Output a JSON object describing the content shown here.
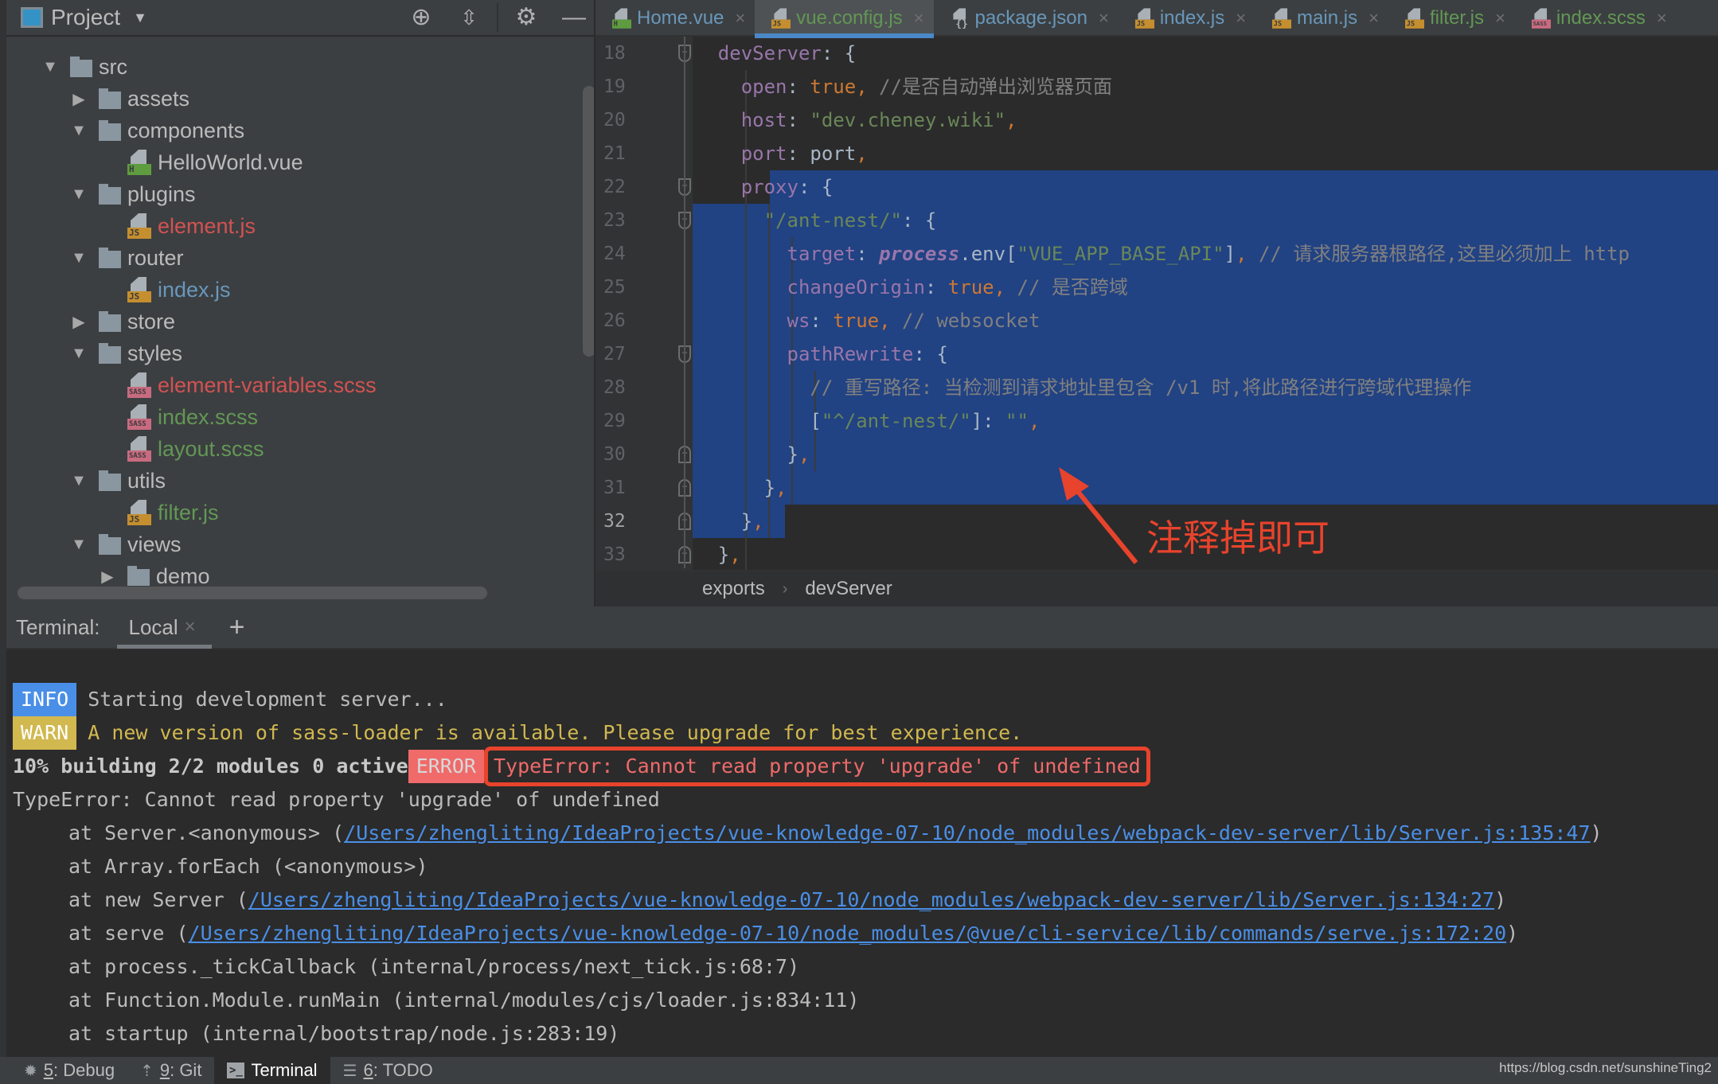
{
  "project_panel": {
    "title": "Project",
    "tools": [
      "locate-icon",
      "collapse-all-icon",
      "gear-icon",
      "minimize-icon"
    ],
    "tree": [
      {
        "label": "src",
        "kind": "folder",
        "depth": 0,
        "expanded": true,
        "color": "gray"
      },
      {
        "label": "assets",
        "kind": "folder",
        "depth": 1,
        "expanded": false,
        "color": "gray"
      },
      {
        "label": "components",
        "kind": "folder",
        "depth": 1,
        "expanded": true,
        "color": "gray"
      },
      {
        "label": "HelloWorld.vue",
        "kind": "vue",
        "depth": 2,
        "color": "gray"
      },
      {
        "label": "plugins",
        "kind": "folder",
        "depth": 1,
        "expanded": true,
        "color": "gray"
      },
      {
        "label": "element.js",
        "kind": "js",
        "depth": 2,
        "color": "red"
      },
      {
        "label": "router",
        "kind": "folder",
        "depth": 1,
        "expanded": true,
        "color": "gray"
      },
      {
        "label": "index.js",
        "kind": "js",
        "depth": 2,
        "color": "blue"
      },
      {
        "label": "store",
        "kind": "folder",
        "depth": 1,
        "expanded": false,
        "color": "gray"
      },
      {
        "label": "styles",
        "kind": "folder",
        "depth": 1,
        "expanded": true,
        "color": "gray"
      },
      {
        "label": "element-variables.scss",
        "kind": "sass",
        "depth": 2,
        "color": "red"
      },
      {
        "label": "index.scss",
        "kind": "sass",
        "depth": 2,
        "color": "green"
      },
      {
        "label": "layout.scss",
        "kind": "sass",
        "depth": 2,
        "color": "green"
      },
      {
        "label": "utils",
        "kind": "folder",
        "depth": 1,
        "expanded": true,
        "color": "gray"
      },
      {
        "label": "filter.js",
        "kind": "js",
        "depth": 2,
        "color": "green"
      },
      {
        "label": "views",
        "kind": "folder",
        "depth": 1,
        "expanded": true,
        "color": "gray"
      },
      {
        "label": "demo",
        "kind": "folder",
        "depth": 2,
        "expanded": false,
        "color": "gray"
      }
    ]
  },
  "editor": {
    "tabs": [
      {
        "label": "Home.vue",
        "kind": "vue",
        "color": "blue",
        "active": false
      },
      {
        "label": "vue.config.js",
        "kind": "js",
        "color": "green",
        "active": true
      },
      {
        "label": "package.json",
        "kind": "json",
        "color": "blue",
        "active": false
      },
      {
        "label": "index.js",
        "kind": "js",
        "color": "blue",
        "active": false
      },
      {
        "label": "main.js",
        "kind": "js",
        "color": "blue",
        "active": false
      },
      {
        "label": "filter.js",
        "kind": "js",
        "color": "green",
        "active": false
      },
      {
        "label": "index.scss",
        "kind": "sass",
        "color": "green",
        "active": false
      }
    ],
    "current_line": 32,
    "lines": [
      {
        "n": 18,
        "fold": "open",
        "tokens": [
          [
            "    ",
            "plain"
          ],
          [
            "devServer",
            "prop"
          ],
          [
            ": {",
            "plain"
          ]
        ]
      },
      {
        "n": 19,
        "tokens": [
          [
            "      ",
            "plain"
          ],
          [
            "open",
            "prop"
          ],
          [
            ": ",
            "plain"
          ],
          [
            "true,",
            "kw"
          ],
          [
            " //是否自动弹出浏览器页面",
            "cmt"
          ]
        ]
      },
      {
        "n": 20,
        "tokens": [
          [
            "      ",
            "plain"
          ],
          [
            "host",
            "prop"
          ],
          [
            ": ",
            "plain"
          ],
          [
            "\"dev.cheney.wiki\"",
            "str"
          ],
          [
            ",",
            "kw"
          ]
        ]
      },
      {
        "n": 21,
        "tokens": [
          [
            "      ",
            "plain"
          ],
          [
            "port",
            "prop"
          ],
          [
            ": port",
            "plain"
          ],
          [
            ",",
            "kw"
          ]
        ]
      },
      {
        "n": 22,
        "fold": "open",
        "tokens": [
          [
            "      ",
            "plain"
          ],
          [
            "proxy",
            "prop"
          ],
          [
            ": {",
            "plain"
          ]
        ]
      },
      {
        "n": 23,
        "fold": "open",
        "tokens": [
          [
            "        ",
            "plain"
          ],
          [
            "\"/ant-nest/\"",
            "str"
          ],
          [
            ": {",
            "plain"
          ]
        ]
      },
      {
        "n": 24,
        "tokens": [
          [
            "          ",
            "plain"
          ],
          [
            "target",
            "prop"
          ],
          [
            ": ",
            "plain"
          ],
          [
            "process",
            "italic"
          ],
          [
            ".env[",
            "plain"
          ],
          [
            "\"VUE_APP_BASE_API\"",
            "str"
          ],
          [
            "]",
            "plain"
          ],
          [
            ",",
            "kw"
          ],
          [
            " // 请求服务器根路径,这里必须加上 http",
            "cmt"
          ]
        ]
      },
      {
        "n": 25,
        "tokens": [
          [
            "          ",
            "plain"
          ],
          [
            "changeOrigin",
            "prop"
          ],
          [
            ": ",
            "plain"
          ],
          [
            "true,",
            "kw"
          ],
          [
            " // 是否跨域",
            "cmt"
          ]
        ]
      },
      {
        "n": 26,
        "tokens": [
          [
            "          ",
            "plain"
          ],
          [
            "ws",
            "prop"
          ],
          [
            ": ",
            "plain"
          ],
          [
            "true,",
            "kw"
          ],
          [
            " // websocket",
            "cmt"
          ]
        ]
      },
      {
        "n": 27,
        "fold": "open",
        "tokens": [
          [
            "          ",
            "plain"
          ],
          [
            "pathRewrite",
            "prop"
          ],
          [
            ": {",
            "plain"
          ]
        ]
      },
      {
        "n": 28,
        "tokens": [
          [
            "            ",
            "plain"
          ],
          [
            "// 重写路径: 当检测到请求地址里包含 /v1 时,将此路径进行跨域代理操作",
            "cmt"
          ]
        ]
      },
      {
        "n": 29,
        "tokens": [
          [
            "            ",
            "plain"
          ],
          [
            "[",
            "plain"
          ],
          [
            "\"^/ant-nest/\"",
            "str"
          ],
          [
            "]: ",
            "plain"
          ],
          [
            "\"\"",
            "str"
          ],
          [
            ",",
            "kw"
          ]
        ]
      },
      {
        "n": 30,
        "fold": "close",
        "tokens": [
          [
            "          ",
            "plain"
          ],
          [
            "}",
            "plain"
          ],
          [
            ",",
            "kw"
          ]
        ]
      },
      {
        "n": 31,
        "fold": "close",
        "tokens": [
          [
            "        ",
            "plain"
          ],
          [
            "}",
            "plain"
          ],
          [
            ",",
            "kw"
          ]
        ]
      },
      {
        "n": 32,
        "fold": "close",
        "tokens": [
          [
            "      ",
            "plain"
          ],
          [
            "}",
            "plain"
          ],
          [
            ",",
            "kw"
          ]
        ]
      },
      {
        "n": 33,
        "fold": "close",
        "tokens": [
          [
            "    ",
            "plain"
          ],
          [
            "}",
            "plain"
          ],
          [
            ",",
            "kw"
          ]
        ]
      }
    ],
    "breadcrumb": [
      "exports",
      "devServer"
    ],
    "annotation": "注释掉即可"
  },
  "terminal": {
    "label": "Terminal:",
    "tab": "Local",
    "lines": [
      {
        "tag": "INFO",
        "text": "Starting development server...",
        "style": "normal"
      },
      {
        "tag": "WARN",
        "text": "A new version of sass-loader is available. Please upgrade for best experience.",
        "style": "warn"
      },
      {
        "prefix": "10% building 2/2 modules 0 active",
        "tag": "ERROR",
        "text": "TypeError: Cannot read property 'upgrade' of undefined",
        "style": "error"
      },
      {
        "text": "TypeError: Cannot read property 'upgrade' of undefined",
        "style": "normal"
      },
      {
        "text": "at Server.<anonymous> (",
        "link": "/Users/zhengliting/IdeaProjects/vue-knowledge-07-10/node_modules/webpack-dev-server/lib/Server.js:135:47",
        "after": ")",
        "indent": true
      },
      {
        "text": "at Array.forEach (<anonymous>)",
        "indent": true
      },
      {
        "text": "at new Server (",
        "link": "/Users/zhengliting/IdeaProjects/vue-knowledge-07-10/node_modules/webpack-dev-server/lib/Server.js:134:27",
        "after": ")",
        "indent": true
      },
      {
        "text": "at serve (",
        "link": "/Users/zhengliting/IdeaProjects/vue-knowledge-07-10/node_modules/@vue/cli-service/lib/commands/serve.js:172:20",
        "after": ")",
        "indent": true
      },
      {
        "text": "at process._tickCallback (internal/process/next_tick.js:68:7)",
        "indent": true
      },
      {
        "text": "at Function.Module.runMain (internal/modules/cjs/loader.js:834:11)",
        "indent": true
      },
      {
        "text": "at startup (internal/bootstrap/node.js:283:19)",
        "indent": true
      }
    ]
  },
  "statusbar": {
    "items": [
      {
        "key": "5",
        "label": ": Debug",
        "icon": "bug-icon",
        "active": false
      },
      {
        "key": "9",
        "label": ": Git",
        "icon": "git-icon",
        "active": false
      },
      {
        "key": "",
        "label": "Terminal",
        "icon": "terminal-icon",
        "active": true
      },
      {
        "key": "6",
        "label": ": TODO",
        "icon": "todo-icon",
        "active": false
      }
    ],
    "watermark": "https://blog.csdn.net/sunshineTing2"
  },
  "colors": {
    "selection": "#214283",
    "annotation": "#e8432c",
    "info": "#4a8fe7",
    "warn": "#d1b84f",
    "error": "#f06a6a"
  }
}
